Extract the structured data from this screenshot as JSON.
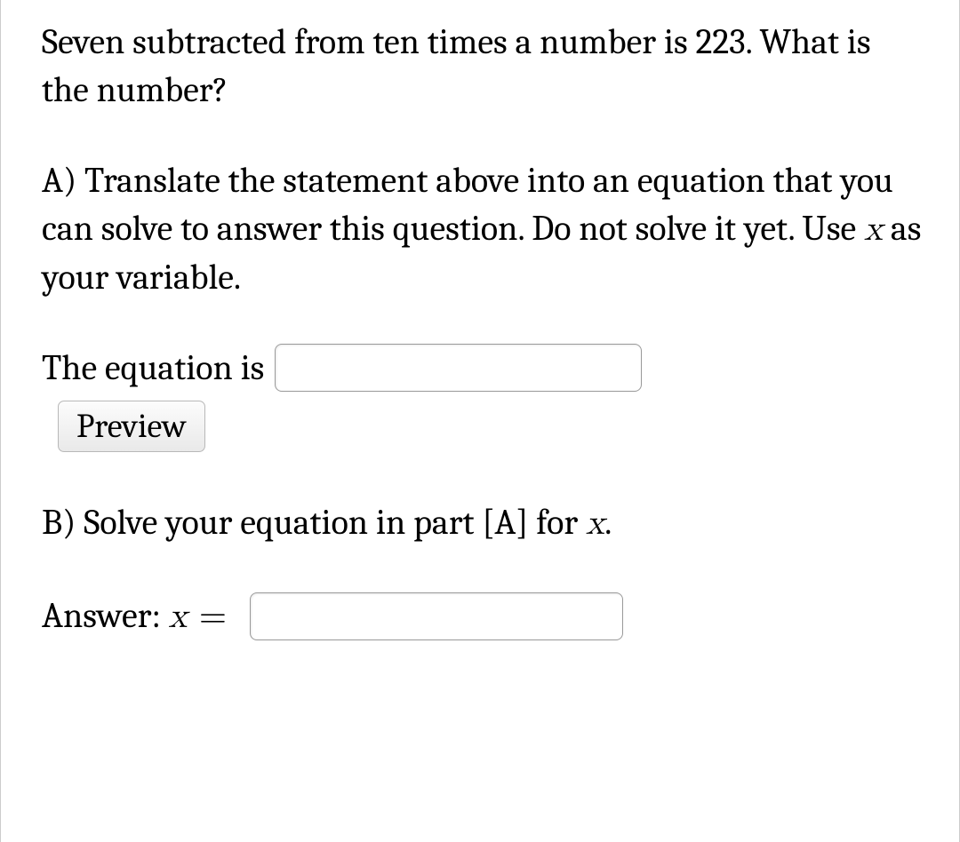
{
  "problem": {
    "statement": "Seven subtracted from ten times a number is 223. What is the number?"
  },
  "partA": {
    "prompt_pre": "A) Translate the statement above into an equation that you can solve to answer this question. Do not solve it yet. Use ",
    "variable": "x",
    "prompt_post": " as your variable.",
    "equation_label": "The equation is",
    "equation_value": "",
    "preview_label": "Preview"
  },
  "partB": {
    "prompt_pre": "B) Solve your equation in part [A] for ",
    "variable": "x",
    "prompt_post": ".",
    "answer_label_pre": "Answer: ",
    "answer_variable": "x",
    "answer_eq": " = ",
    "answer_value": ""
  }
}
